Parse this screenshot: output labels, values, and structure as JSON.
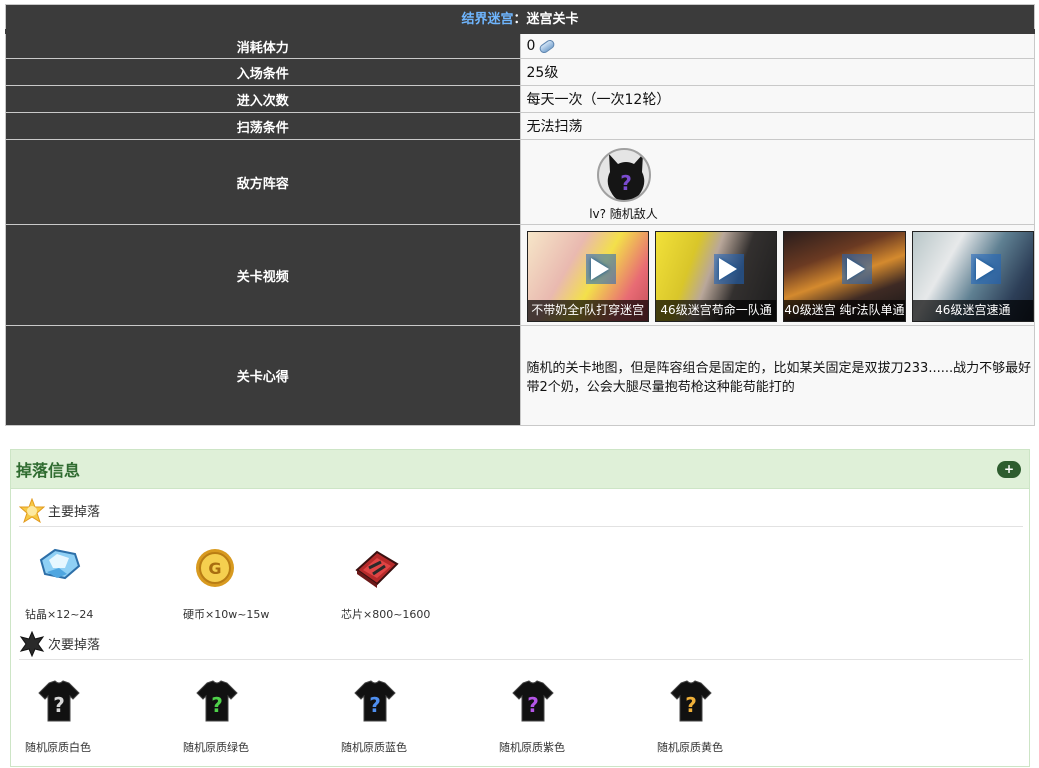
{
  "header": {
    "title_link": "结界迷宫",
    "title_sep": "：",
    "title_rest": "迷宫关卡"
  },
  "rows": {
    "stamina": {
      "label": "消耗体力",
      "value": "0"
    },
    "entry": {
      "label": "入场条件",
      "value": "25级"
    },
    "times": {
      "label": "进入次数",
      "value": "每天一次（一次12轮）"
    },
    "sweep": {
      "label": "扫荡条件",
      "value": "无法扫荡"
    },
    "enemy": {
      "label": "敌方阵容",
      "name": "lv?  随机敌人"
    },
    "videos": {
      "label": "关卡视频",
      "items": [
        {
          "caption": "不带奶全r队打穿迷宫"
        },
        {
          "caption": "46级迷宫苟命一队通"
        },
        {
          "caption": "40级迷宫 纯r法队单通"
        },
        {
          "caption": "46级迷宫速通"
        }
      ]
    },
    "tips": {
      "label": "关卡心得",
      "value": "随机的关卡地图，但是阵容组合是固定的，比如某关固定是双拔刀233......战力不够最好带2个奶，公会大腿尽量抱苟枪这种能苟能打的"
    }
  },
  "drops": {
    "title": "掉落信息",
    "toggle": "+",
    "primary": {
      "label": "主要掉落",
      "items": [
        {
          "name": "钻晶×12~24",
          "icon": "diamond-icon"
        },
        {
          "name": "硬币×10w~15w",
          "icon": "coin-icon"
        },
        {
          "name": "芯片×800~1600",
          "icon": "chip-icon"
        }
      ]
    },
    "secondary": {
      "label": "次要掉落",
      "items": [
        {
          "name": "随机原质白色",
          "icon": "shirt-icon",
          "color": "#d8d8d8"
        },
        {
          "name": "随机原质绿色",
          "icon": "shirt-icon",
          "color": "#4fd24a"
        },
        {
          "name": "随机原质蓝色",
          "icon": "shirt-icon",
          "color": "#4f8ff0"
        },
        {
          "name": "随机原质紫色",
          "icon": "shirt-icon",
          "color": "#b455e6"
        },
        {
          "name": "随机原质黄色",
          "icon": "shirt-icon",
          "color": "#f0b13a"
        }
      ]
    }
  }
}
